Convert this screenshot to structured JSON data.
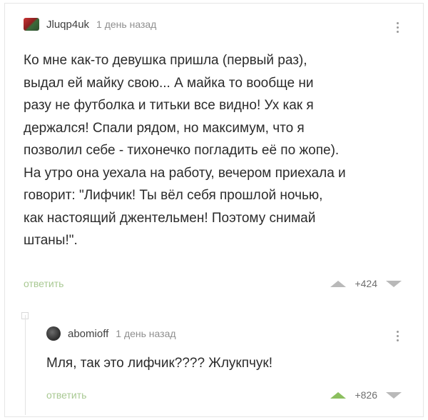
{
  "comments": [
    {
      "username": "Jluqp4uk",
      "time": "1 день назад",
      "text": "Ко мне как-то девушка пришла (первый раз),\nвыдал ей майку свою... А майка то вообще ни\nразу не футболка и титьки все видно! Ух как я\nдержался! Спали рядом, но максимум, что я\nпозволил себе - тихонечко погладить её по жопе).\nНа утро она уехала на работу, вечером приехала и\nговорит: \"Лифчик! Ты вёл себя прошлой ночью,\nкак настоящий джентельмен! Поэтому снимай\nштаны!\".",
      "reply_label": "ответить",
      "score": "+424"
    },
    {
      "username": "abomioff",
      "time": "1 день назад",
      "text": "Мля, так это лифчик???? Жлукпчук!",
      "reply_label": "ответить",
      "score": "+826"
    }
  ],
  "colors": {
    "reply": "#a9c993",
    "upvote_active": "#8bbf5e",
    "arrow_inactive": "#b9b9b9"
  },
  "icons": {
    "menu": "vertical-dots-icon",
    "upvote": "triangle-up-icon",
    "downvote": "triangle-down-icon"
  }
}
